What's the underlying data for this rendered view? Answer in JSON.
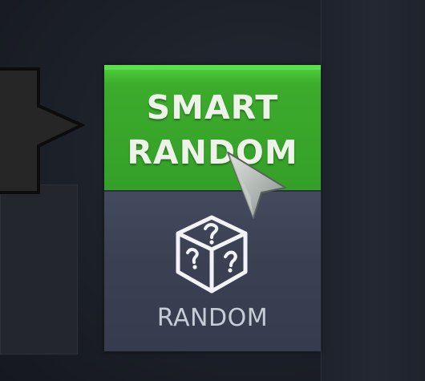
{
  "buttons": {
    "smart_random": {
      "line1": "SMART",
      "line2": "RANDOM"
    },
    "random": {
      "label": "RANDOM",
      "icon": "mystery-dice-icon"
    }
  },
  "colors": {
    "smart_green": "#38a52a",
    "random_slate": "#3b4153",
    "background": "#1c2029"
  },
  "cursor": {
    "icon": "arrow-cursor-icon"
  }
}
